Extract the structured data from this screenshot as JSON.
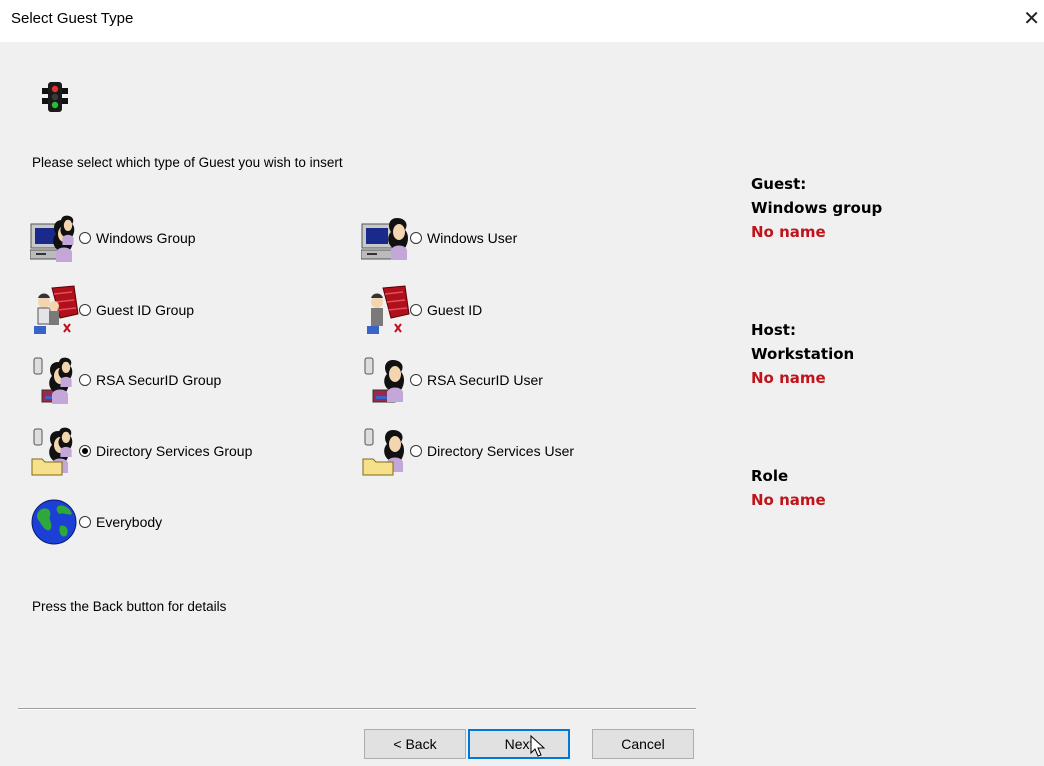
{
  "window": {
    "title": "Select Guest Type",
    "close_glyph": "✕"
  },
  "prompt": "Please select which type of Guest you wish to insert",
  "options": [
    {
      "label": "Windows Group",
      "icon": "windows-group-icon",
      "selected": false
    },
    {
      "label": "Windows User",
      "icon": "windows-user-icon",
      "selected": false
    },
    {
      "label": "Guest ID Group",
      "icon": "guest-id-group-icon",
      "selected": false
    },
    {
      "label": "Guest ID",
      "icon": "guest-id-icon",
      "selected": false
    },
    {
      "label": "RSA SecurID Group",
      "icon": "rsa-securid-group-icon",
      "selected": false
    },
    {
      "label": "RSA SecurID User",
      "icon": "rsa-securid-user-icon",
      "selected": false
    },
    {
      "label": "Directory Services Group",
      "icon": "directory-services-group-icon",
      "selected": true
    },
    {
      "label": "Directory Services User",
      "icon": "directory-services-user-icon",
      "selected": false
    },
    {
      "label": "Everybody",
      "icon": "globe-icon",
      "selected": false
    }
  ],
  "hint": "Press the Back button for details",
  "summary": {
    "guest_label": "Guest:",
    "guest_type": "Windows group",
    "guest_name": "No name",
    "host_label": "Host:",
    "host_type": "Workstation",
    "host_name": "No name",
    "role_label": "Role",
    "role_name": "No name"
  },
  "buttons": {
    "back": "< Back",
    "next": "Next",
    "cancel": "Cancel"
  },
  "colors": {
    "value_red": "#c0141c",
    "default_button_border": "#0078d7"
  }
}
